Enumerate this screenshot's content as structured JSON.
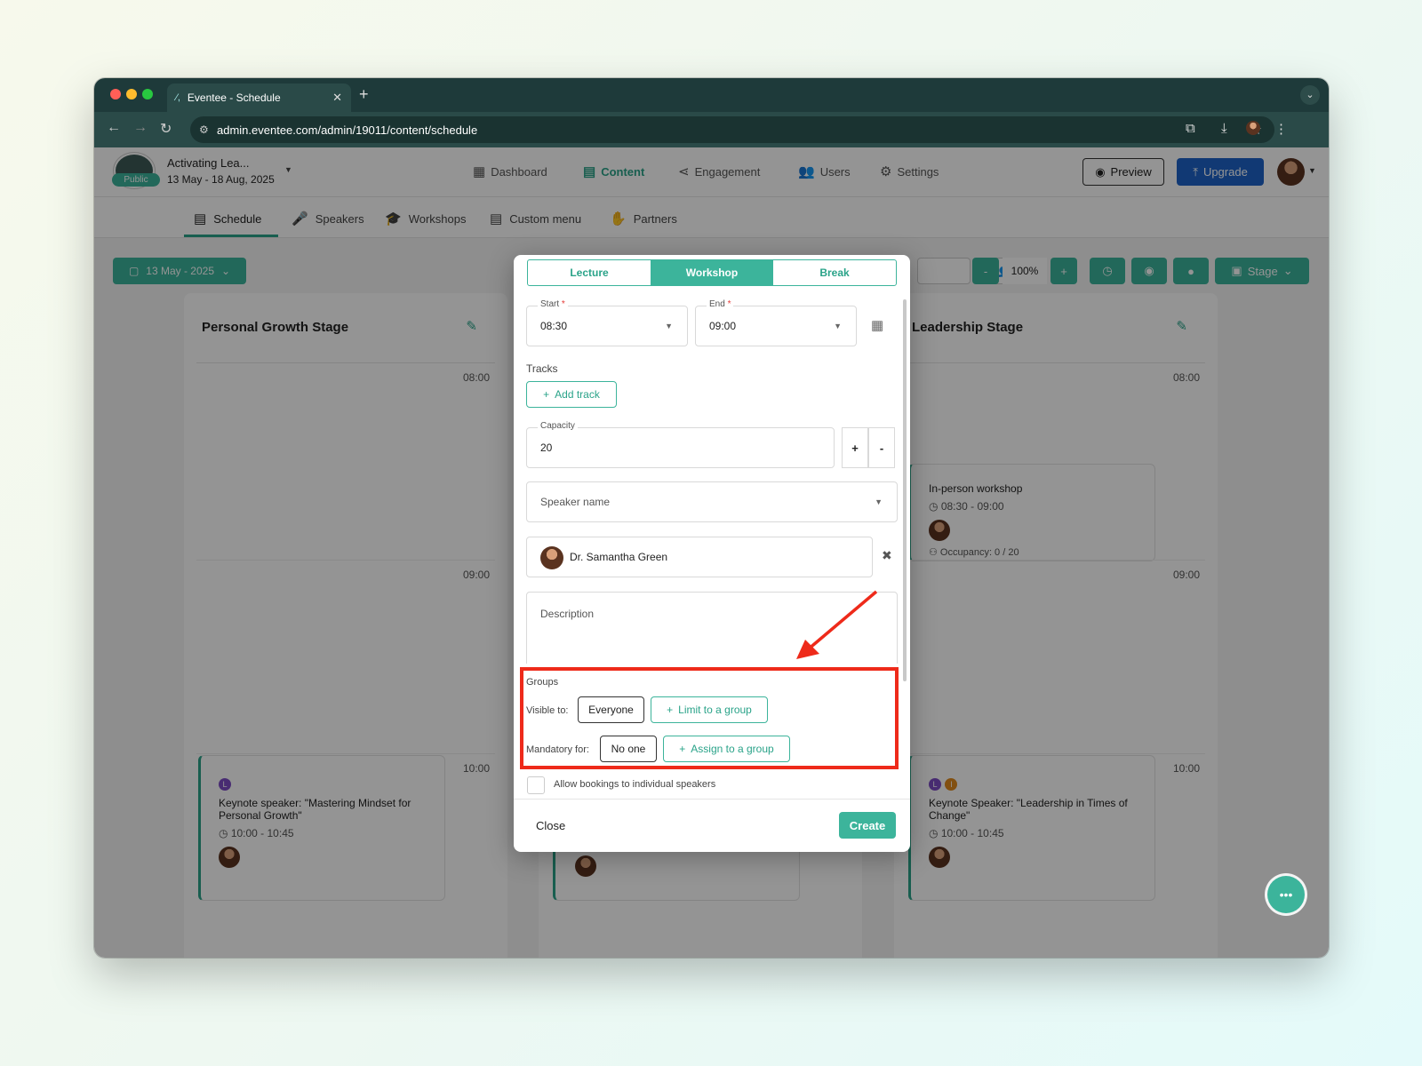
{
  "browser": {
    "tab_title": "Eventee - Schedule",
    "url": "admin.eventee.com/admin/19011/content/schedule"
  },
  "event": {
    "name": "Activating Lea...",
    "dates": "13 May - 18 Aug, 2025",
    "visibility": "Public"
  },
  "main_nav": [
    {
      "label": "Dashboard",
      "icon": "grid-icon"
    },
    {
      "label": "Content",
      "icon": "calendar-icon",
      "active": true
    },
    {
      "label": "Engagement",
      "icon": "share-icon"
    },
    {
      "label": "Users",
      "icon": "users-icon"
    },
    {
      "label": "Settings",
      "icon": "gear-icon"
    }
  ],
  "actions": {
    "preview": "Preview",
    "upgrade": "Upgrade"
  },
  "sub_nav": [
    {
      "label": "Schedule",
      "icon": "calendar-icon",
      "active": true
    },
    {
      "label": "Speakers",
      "icon": "speaker-icon"
    },
    {
      "label": "Workshops",
      "icon": "graduation-cap-icon"
    },
    {
      "label": "Custom menu",
      "icon": "document-icon"
    },
    {
      "label": "Partners",
      "icon": "handshake-icon"
    }
  ],
  "toolbar": {
    "date": "13 May - 2025",
    "zoom": "100%",
    "zoom_minus": "-",
    "zoom_plus": "+",
    "stage": "Stage"
  },
  "stages": [
    {
      "name": "Personal Growth Stage",
      "times": [
        "08:00",
        "09:00",
        "10:00"
      ],
      "session": {
        "badges": [
          "L"
        ],
        "title": "Keynote speaker: \"Mastering Mindset for Personal Growth\"",
        "time": "10:00 - 10:45"
      }
    },
    {
      "name": "Leadership Stage",
      "times": [
        "08:00",
        "09:00",
        "10:00"
      ],
      "workshop": {
        "title": "In-person workshop",
        "time": "08:30 - 09:00",
        "occupancy": "Occupancy: 0 / 20"
      },
      "session": {
        "badges": [
          "L",
          "I"
        ],
        "title": "Keynote Speaker: \"Leadership in Times of Change\"",
        "time": "10:00 - 10:45"
      }
    }
  ],
  "modal": {
    "types": [
      "Lecture",
      "Workshop",
      "Break"
    ],
    "active_type": "Workshop",
    "start_label": "Start",
    "start_value": "08:30",
    "end_label": "End",
    "end_value": "09:00",
    "required_mark": "*",
    "tracks_label": "Tracks",
    "add_track": "Add track",
    "capacity_label": "Capacity",
    "capacity_value": "20",
    "capacity_plus": "+",
    "capacity_minus": "-",
    "speaker_placeholder": "Speaker name",
    "selected_speaker": "Dr. Samantha Green",
    "description_placeholder": "Description",
    "groups_label": "Groups",
    "visible_to_label": "Visible to:",
    "visible_to_value": "Everyone",
    "limit_group": "Limit to a group",
    "mandatory_for_label": "Mandatory for:",
    "mandatory_for_value": "No one",
    "assign_group": "Assign to a group",
    "allow_bookings": "Allow bookings to individual speakers",
    "close": "Close",
    "create": "Create"
  },
  "colors": {
    "accent": "#3cb49b",
    "browser_frame": "#1e3a3a",
    "upgrade": "#1e63c8",
    "highlight": "#ee2a1a"
  }
}
